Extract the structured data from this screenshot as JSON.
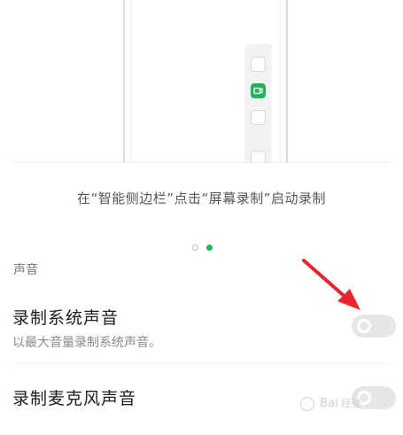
{
  "illustration": {
    "caption": "在“智能侧边栏”点击“屏幕录制”启动录制",
    "pager": {
      "total": 2,
      "active": 2
    }
  },
  "section": {
    "title": "声音"
  },
  "settings": [
    {
      "title": "录制系统声音",
      "description": "以最大音量录制系统声音。",
      "enabled": false
    },
    {
      "title": "录制麦克风声音",
      "enabled": false
    }
  ],
  "colors": {
    "accent": "#21b35f",
    "arrow": "#e8262c",
    "toggle_off": "#e6e6e6"
  },
  "icons": {
    "record": "screen-record-icon"
  }
}
